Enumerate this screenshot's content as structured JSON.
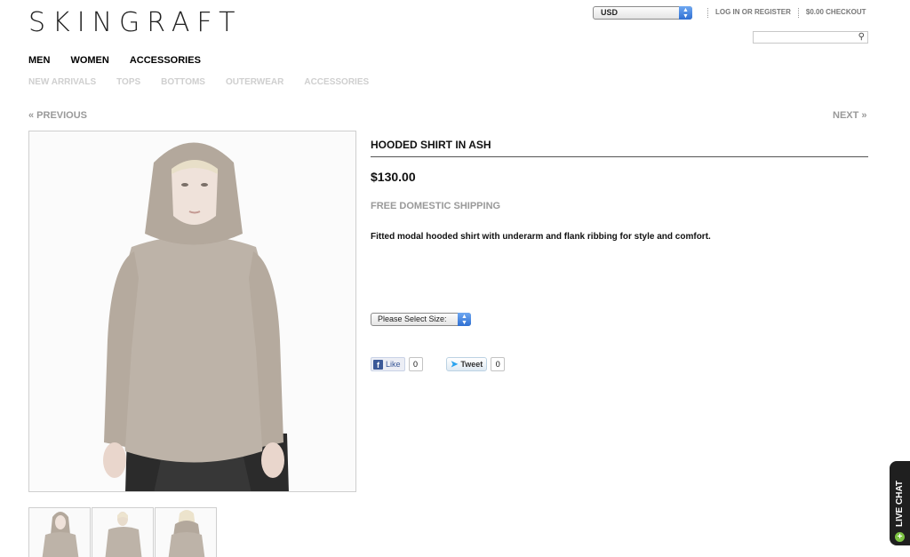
{
  "header": {
    "logo": "SKINGRAFT",
    "currency": "USD",
    "login": "LOG IN OR REGISTER",
    "checkout": "$0.00 CHECKOUT",
    "search_placeholder": ""
  },
  "nav": {
    "main": [
      "MEN",
      "WOMEN",
      "ACCESSORIES"
    ],
    "sub": [
      "NEW ARRIVALS",
      "TOPS",
      "BOTTOMS",
      "OUTERWEAR",
      "ACCESSORIES"
    ]
  },
  "pager": {
    "previous": "« PREVIOUS",
    "next": "NEXT »"
  },
  "product": {
    "title": "HOODED SHIRT IN ASH",
    "price": "$130.00",
    "shipping": "FREE DOMESTIC SHIPPING",
    "description": "Fitted modal hooded shirt with underarm and flank ribbing for style and comfort.",
    "size_select": "Please Select Size:"
  },
  "social": {
    "like_label": "Like",
    "like_count": "0",
    "tweet_label": "Tweet",
    "tweet_count": "0"
  },
  "livechat": {
    "label": "LIVE CHAT"
  },
  "colors": {
    "shirt": "#bdb3a8",
    "accent_blue": "#2f6fd2",
    "muted_text": "#999999"
  }
}
